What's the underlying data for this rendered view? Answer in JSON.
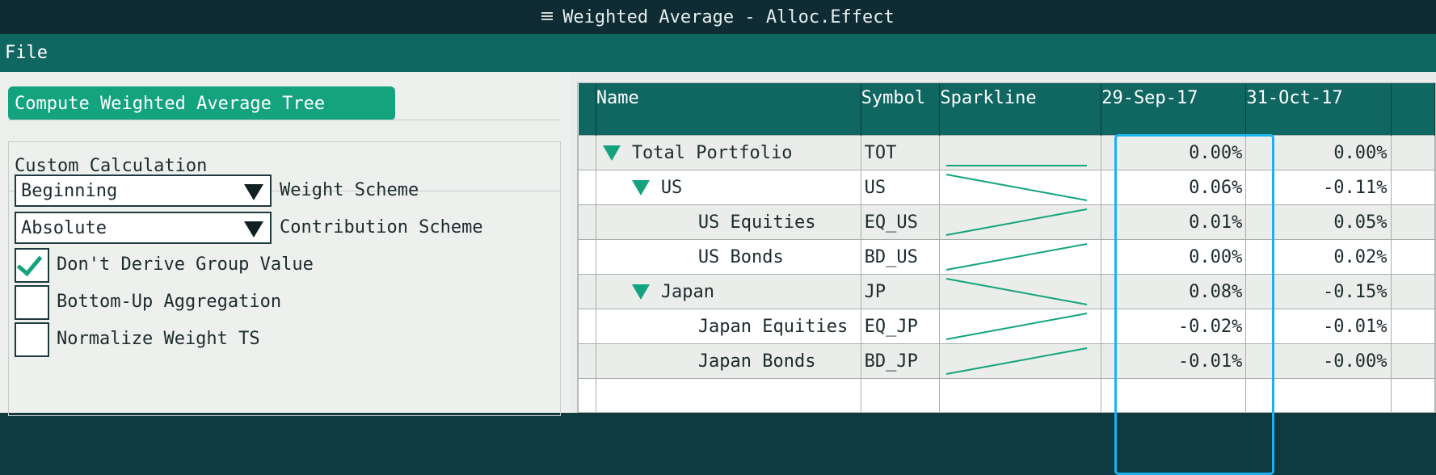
{
  "window": {
    "title": "Weighted Average - Alloc.Effect"
  },
  "menu": {
    "file": "File"
  },
  "panel": {
    "compute_button": "Compute Weighted Average Tree",
    "group_title": "Custom Calculation",
    "weight_scheme": {
      "value": "Beginning",
      "label": "Weight Scheme"
    },
    "contribution_scheme": {
      "value": "Absolute",
      "label": "Contribution Scheme"
    },
    "options": [
      {
        "label": "Don't Derive Group Value",
        "checked": true
      },
      {
        "label": "Bottom-Up Aggregation",
        "checked": false
      },
      {
        "label": "Normalize Weight TS",
        "checked": false
      }
    ]
  },
  "grid": {
    "columns": [
      "Name",
      "Symbol",
      "Sparkline",
      "29-Sep-17",
      "31-Oct-17"
    ],
    "rows": [
      {
        "name": "Total Portfolio",
        "symbol": "TOT",
        "expanded": true,
        "level": 0,
        "values": [
          "0.00%",
          "0.00%"
        ]
      },
      {
        "name": "US",
        "symbol": "US",
        "expanded": true,
        "level": 1,
        "values": [
          "0.06%",
          "-0.11%"
        ]
      },
      {
        "name": "US Equities",
        "symbol": "EQ_US",
        "level": 2,
        "values": [
          "0.01%",
          "0.05%"
        ]
      },
      {
        "name": "US Bonds",
        "symbol": "BD_US",
        "level": 2,
        "values": [
          "0.00%",
          "0.02%"
        ]
      },
      {
        "name": "Japan",
        "symbol": "JP",
        "expanded": true,
        "level": 1,
        "values": [
          "0.08%",
          "-0.15%"
        ]
      },
      {
        "name": "Japan Equities",
        "symbol": "EQ_JP",
        "level": 2,
        "values": [
          "-0.02%",
          "-0.01%"
        ]
      },
      {
        "name": "Japan Bonds",
        "symbol": "BD_JP",
        "level": 2,
        "values": [
          "-0.01%",
          "-0.00%"
        ]
      }
    ],
    "sparkline_color": "#13a37e",
    "highlight_color": "#1ab2f0"
  }
}
